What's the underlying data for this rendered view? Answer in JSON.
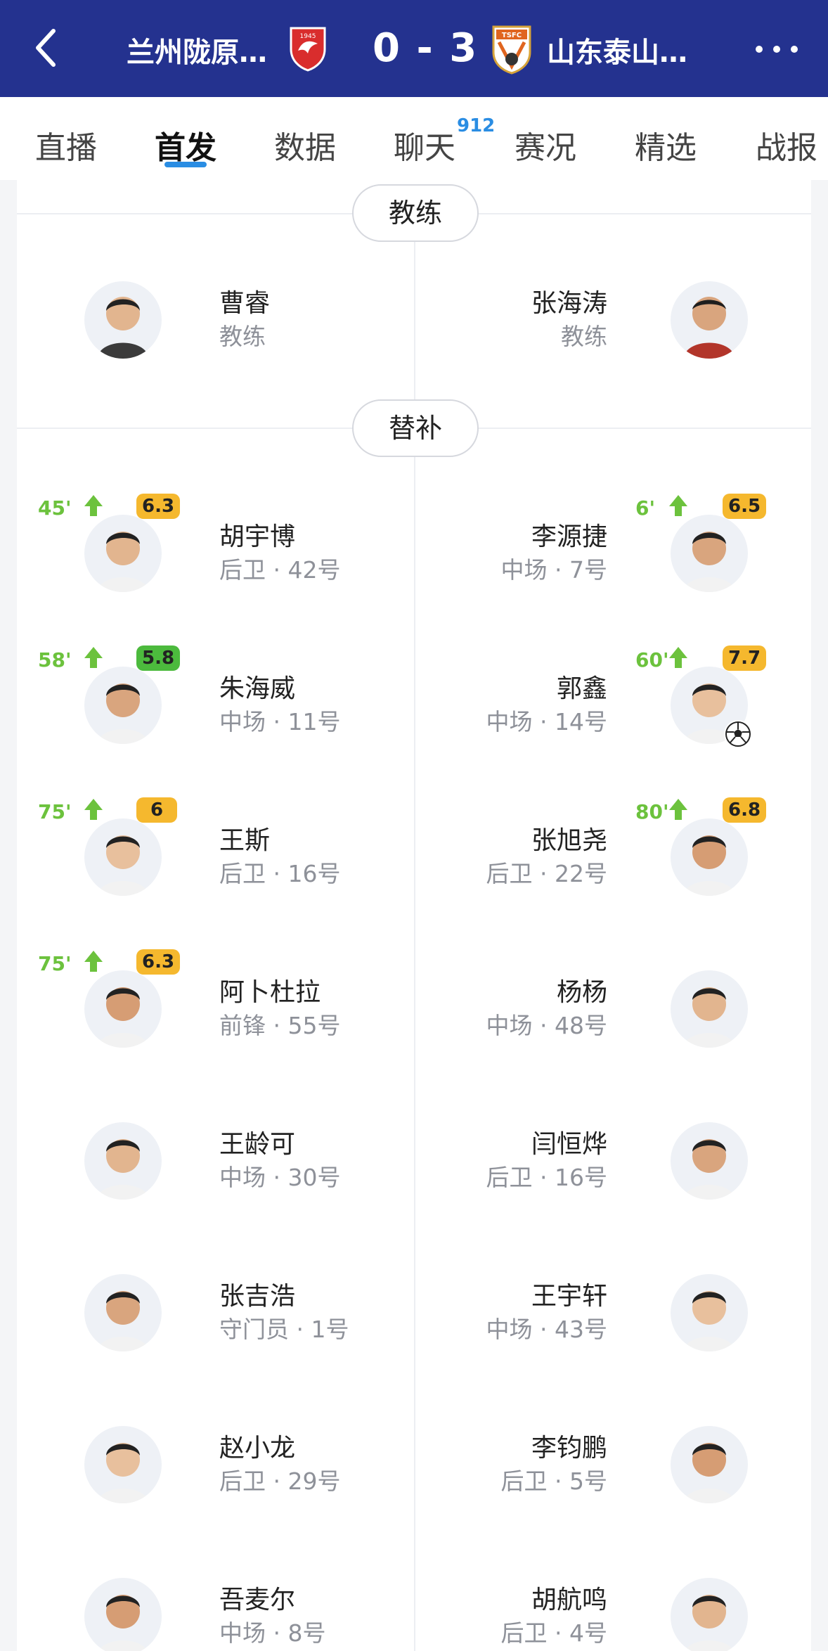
{
  "header": {
    "home_team": "兰州陇原…",
    "score": "0 - 3",
    "away_team": "山东泰山…",
    "home_logo_text": "1945",
    "away_logo_text": "TSFC"
  },
  "tabs": [
    {
      "label": "直播"
    },
    {
      "label": "首发",
      "active": true
    },
    {
      "label": "数据"
    },
    {
      "label": "聊天",
      "badge": "912"
    },
    {
      "label": "赛况"
    },
    {
      "label": "精选"
    },
    {
      "label": "战报"
    }
  ],
  "sections": {
    "coach_title": "教练",
    "subs_title": "替补"
  },
  "coaches": {
    "home": {
      "name": "曹睿",
      "role": "教练"
    },
    "away": {
      "name": "张海涛",
      "role": "教练"
    }
  },
  "subs": {
    "home": [
      {
        "name": "胡宇博",
        "info": "后卫 · 42号",
        "minute": "45'",
        "rating": "6.3",
        "rating_color": "yellow"
      },
      {
        "name": "朱海威",
        "info": "中场 · 11号",
        "minute": "58'",
        "rating": "5.8",
        "rating_color": "green"
      },
      {
        "name": "王斯",
        "info": "后卫 · 16号",
        "minute": "75'",
        "rating": "6",
        "rating_color": "yellow"
      },
      {
        "name": "阿卜杜拉",
        "info": "前锋 · 55号",
        "minute": "75'",
        "rating": "6.3",
        "rating_color": "yellow"
      },
      {
        "name": "王龄可",
        "info": "中场 · 30号"
      },
      {
        "name": "张吉浩",
        "info": "守门员 · 1号"
      },
      {
        "name": "赵小龙",
        "info": "后卫 · 29号"
      },
      {
        "name": "吾麦尔",
        "info": "中场 · 8号"
      }
    ],
    "away": [
      {
        "name": "李源捷",
        "info": "中场 · 7号",
        "minute": "6'",
        "rating": "6.5",
        "rating_color": "yellow"
      },
      {
        "name": "郭鑫",
        "info": "中场 · 14号",
        "minute": "60'",
        "rating": "7.7",
        "rating_color": "yellow",
        "goal": true
      },
      {
        "name": "张旭尧",
        "info": "后卫 · 22号",
        "minute": "80'",
        "rating": "6.8",
        "rating_color": "yellow"
      },
      {
        "name": "杨杨",
        "info": "中场 · 48号"
      },
      {
        "name": "闫恒烨",
        "info": "后卫 · 16号"
      },
      {
        "name": "王宇轩",
        "info": "中场 · 43号"
      },
      {
        "name": "李钧鹏",
        "info": "后卫 · 5号"
      },
      {
        "name": "胡航鸣",
        "info": "后卫 · 4号"
      }
    ]
  },
  "icons": {
    "back": "chevron-left-icon",
    "more": "more-dots-icon",
    "sub_in": "arrow-up-icon",
    "goal": "soccer-ball-icon"
  },
  "colors": {
    "header_bg": "#24328f",
    "accent_blue": "#2a8de3",
    "sub_green": "#6cc23d",
    "rating_yellow": "#f5b82e",
    "rating_green": "#4cba3d"
  }
}
